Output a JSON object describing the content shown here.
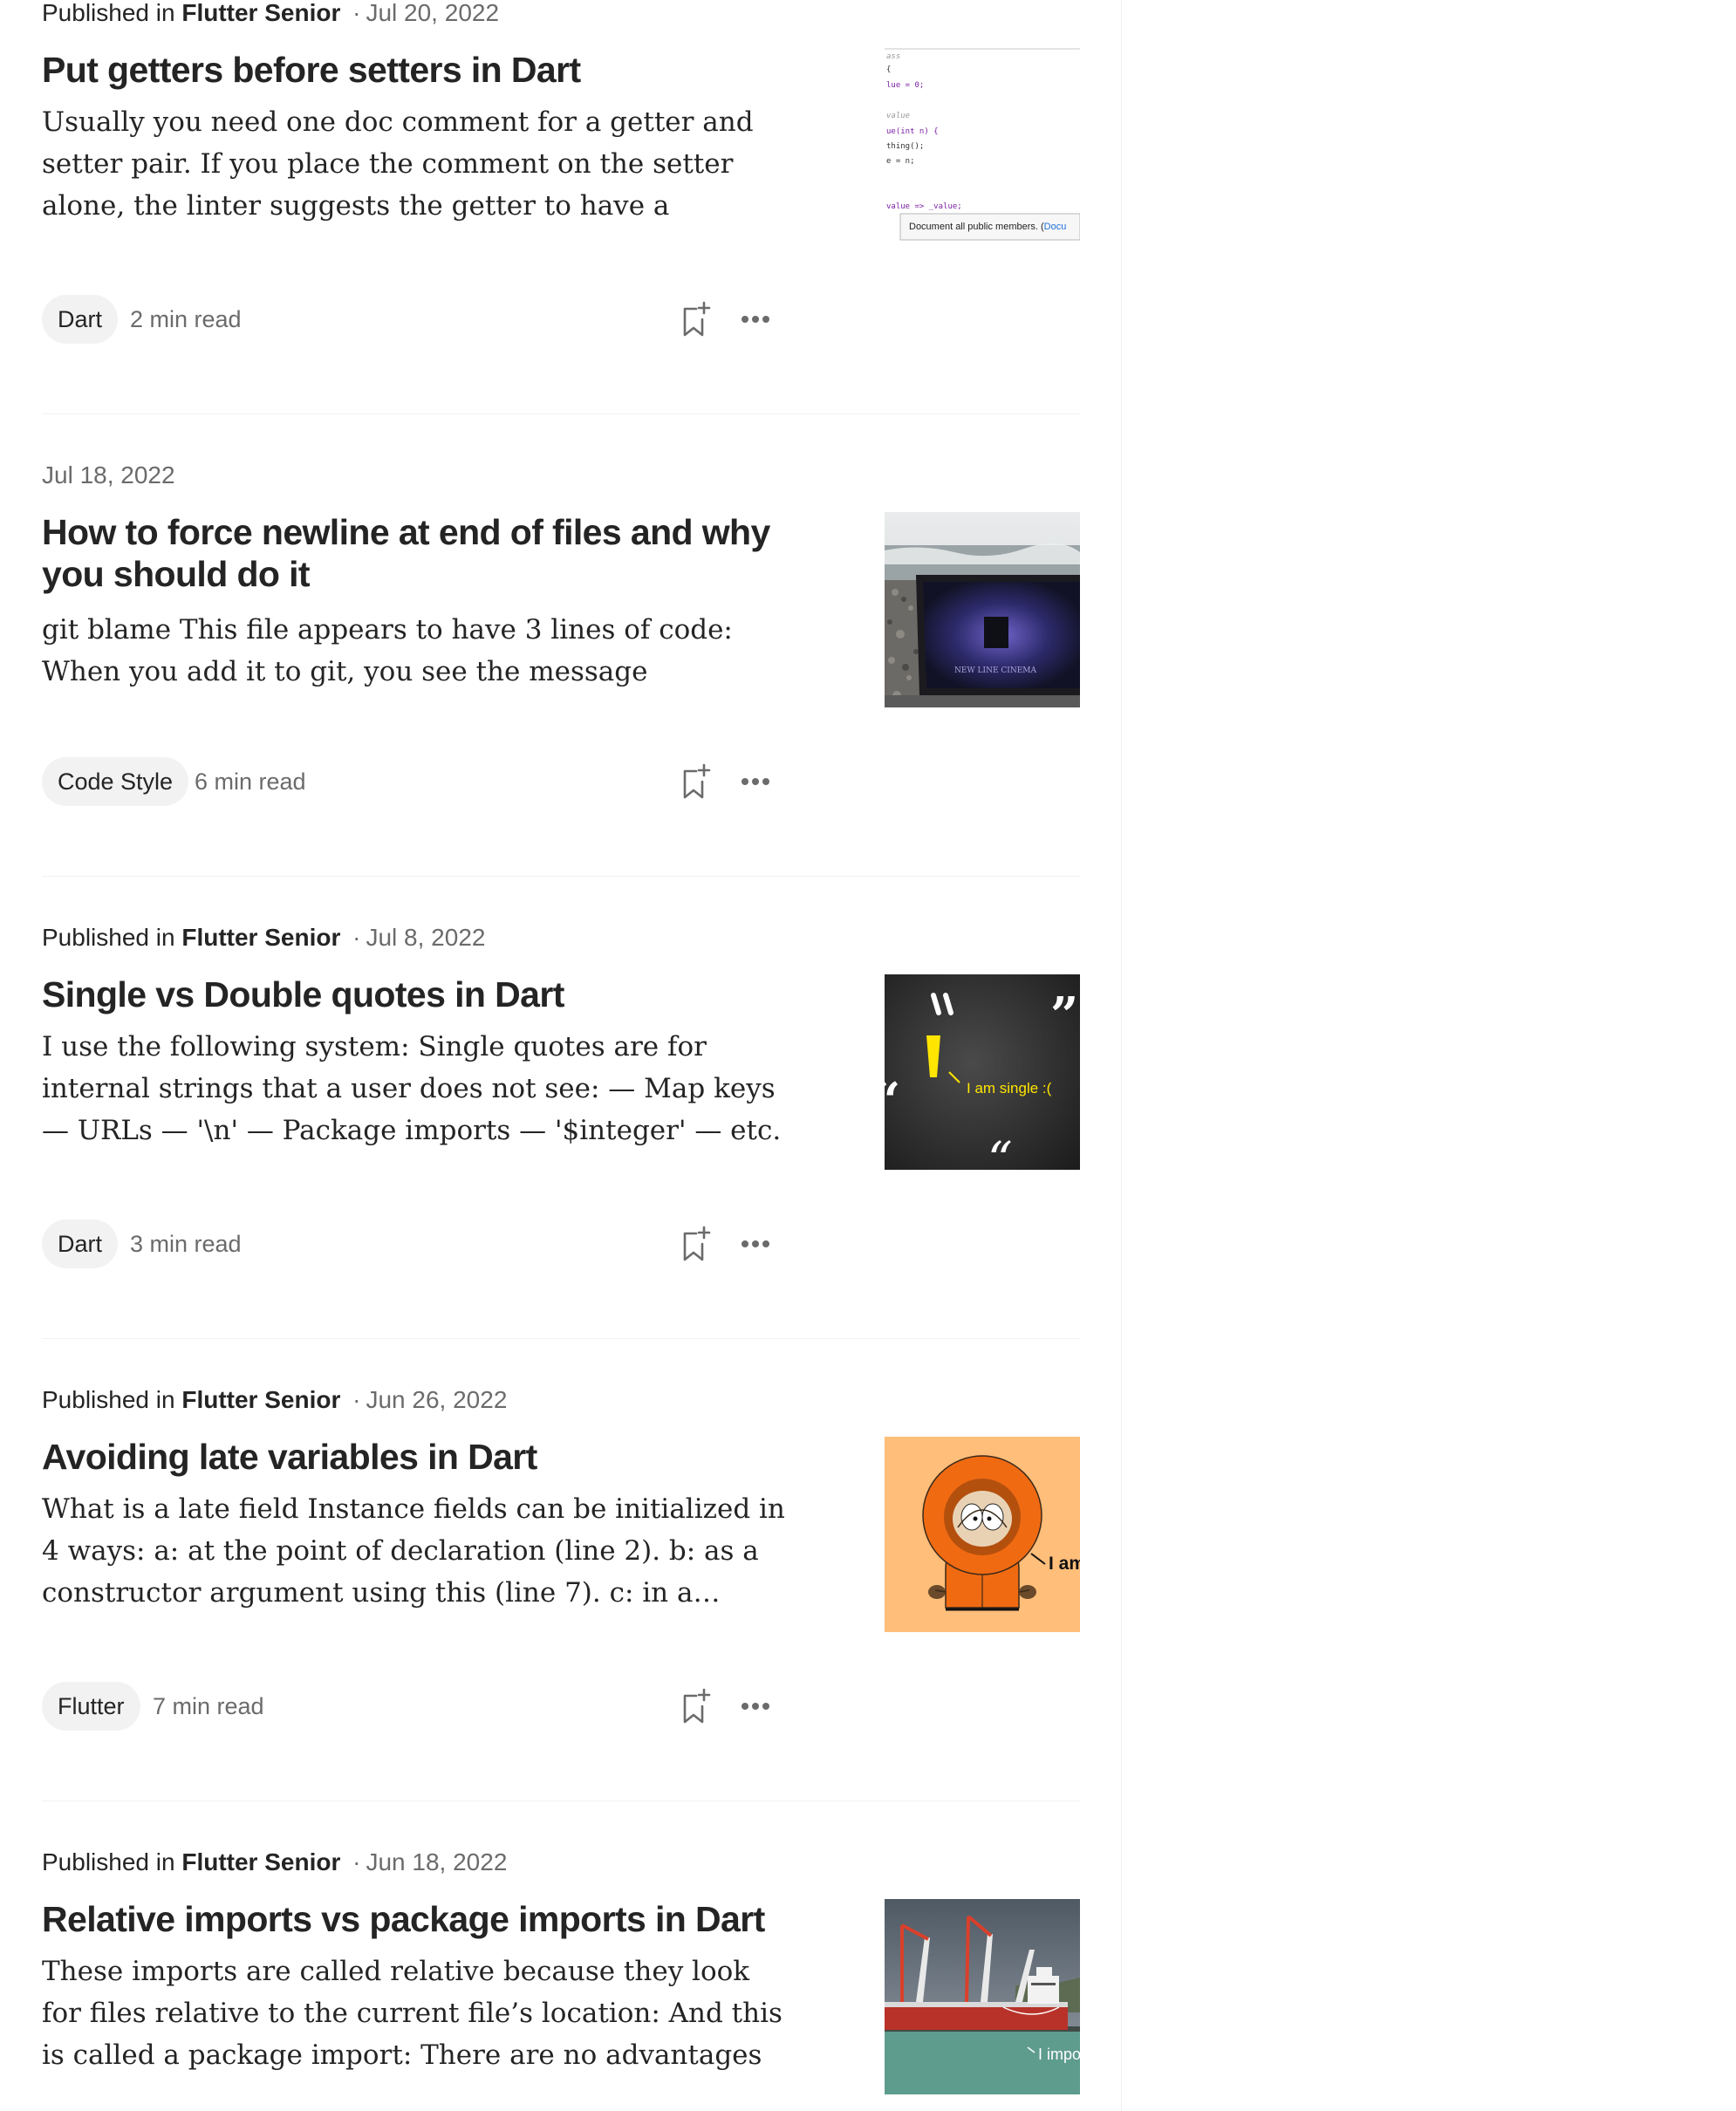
{
  "articles": [
    {
      "pub_prefix": "Published in",
      "publication": "Flutter Senior",
      "separator": "·",
      "date": "Jul 20, 2022",
      "title": "Put getters before setters in Dart",
      "excerpt": "Usually you need one doc comment for a getter and setter pair. If you place the comment on the setter alone, the linter suggests the getter to have a separate comment: Bu…",
      "tag": "Dart",
      "read_time": "2 min read",
      "thumbnail": {
        "code_lines": [
          "ass",
          "{",
          "lue = 0;",
          "value",
          "ue(int n) {",
          "thing();",
          "e = n;",
          "value => _value;"
        ],
        "tooltip_text": "Document all public members. (",
        "tooltip_link": "Docu"
      }
    },
    {
      "pub_prefix": "",
      "publication": "",
      "separator": "",
      "date": "Jul 18, 2022",
      "title": "How to force newline at end of files and why you should do it",
      "excerpt": "git blame This file appears to have 3 lines of code: When you add it to git, you see the message complaining about …",
      "tag": "Code Style",
      "read_time": "6 min read",
      "thumbnail": {
        "screen_text": "NEW LINE CINEMA"
      }
    },
    {
      "pub_prefix": "Published in",
      "publication": "Flutter Senior",
      "separator": "·",
      "date": "Jul 8, 2022",
      "title": "Single vs Double quotes in Dart",
      "excerpt": "I use the following system: Single quotes are for internal strings that a user does not see: — Map keys — URLs — '\\n' — Package imports — '$integer' — etc. Double quotes are…",
      "tag": "Dart",
      "read_time": "3 min read",
      "thumbnail": {
        "caption": "I am single :(",
        "glyph_open": "“",
        "glyph_close": "”",
        "glyph_left": "“",
        "glyph_bottom": "“"
      }
    },
    {
      "pub_prefix": "Published in",
      "publication": "Flutter Senior",
      "separator": "·",
      "date": "Jun 26, 2022",
      "title": "Avoiding late variables in Dart",
      "excerpt": "What is a late field Instance fields can be initialized in 4 ways: a: at the point of declaration (line 2). b: as a constructor argument using this (line 7). c: in a…",
      "tag": "Flutter",
      "read_time": "7 min read",
      "thumbnail": {
        "caption": "I am"
      }
    },
    {
      "pub_prefix": "Published in",
      "publication": "Flutter Senior",
      "separator": "·",
      "date": "Jun 18, 2022",
      "title": "Relative imports vs package imports in Dart",
      "excerpt": "These imports are called relative because they look for files relative to the current file’s location: And this is called a package import: There are no advantages of one way ove…",
      "tag": "",
      "read_time": "",
      "thumbnail": {
        "caption": "I impo"
      }
    }
  ],
  "icons": {
    "save": "bookmark-add-icon",
    "more": "more-horizontal-icon"
  },
  "colors": {
    "text": "#242424",
    "muted": "#6b6b6b",
    "chip_bg": "#f2f2f2",
    "divider": "#f2f2f2",
    "code_keyword": "#7a1fa2",
    "code_link": "#1e6fd9",
    "quote_yellow": "#ffe500",
    "kenny_bg": "#ffbe7a",
    "kenny_orange": "#f06a12"
  }
}
